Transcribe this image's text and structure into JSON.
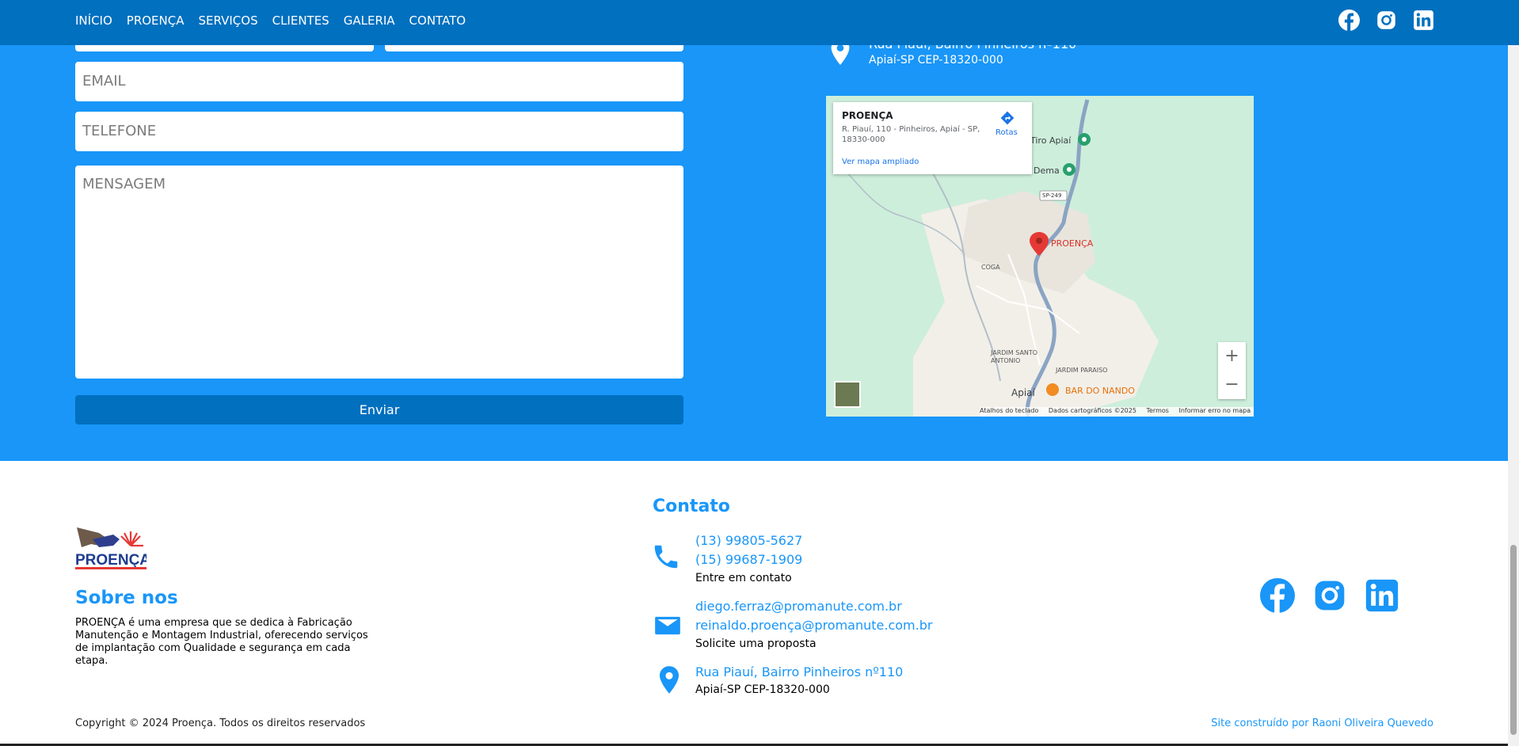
{
  "nav": {
    "links": [
      "INÍCIO",
      "PROENÇA",
      "SERVIÇOS",
      "CLIENTES",
      "GALERIA",
      "CONTATO"
    ],
    "social_icons": [
      "facebook-icon",
      "instagram-icon",
      "linkedin-icon"
    ]
  },
  "form": {
    "email_placeholder": "EMAIL",
    "phone_placeholder": "TELEFONE",
    "message_placeholder": "MENSAGEM",
    "submit_label": "Enviar"
  },
  "address_top": {
    "street": "Rua Piauí, Bairro Pinheiros nº110",
    "city": "Apiaí-SP CEP-18320-000"
  },
  "map": {
    "card_title": "PROENÇA",
    "card_address": "R. Piauí, 110 - Pinheiros, Apiaí - SP, 18330-000",
    "card_link": "Ver mapa ampliado",
    "directions_label": "Rotas",
    "labels": {
      "tiro_apiai": "Tiro Apiaí",
      "dema": "Dema",
      "sp249": "SP-249",
      "proenca": "PROENÇA",
      "coga": "COGA",
      "jardim_santo_antonio": "JARDIM SANTO ANTONIO",
      "jardim_paraiso": "JARDIM PARAISO",
      "apiai": "Apiaí",
      "bar_do_nando": "BAR DO NANDO"
    },
    "zoom_in": "+",
    "zoom_out": "−",
    "footer": [
      "Atalhos do teclado",
      "Dados cartográficos ©2025",
      "Termos",
      "Informar erro no mapa"
    ]
  },
  "footer": {
    "logo_text": "PROENÇA",
    "about_title": "Sobre nos",
    "about_text": "PROENÇA é uma empresa que se dedica à Fabricação Manutenção e Montagem Industrial, oferecendo serviços de implantação com Qualidade e segurança em cada etapa.",
    "contact_title": "Contato",
    "phone1": "(13) 99805-5627",
    "phone2": "(15) 99687-1909",
    "phone_sub": "Entre em contato",
    "email1": "diego.ferraz@promanute.com.br",
    "email2": "reinaldo.proença@promanute.com.br",
    "email_sub": "Solicite uma proposta",
    "address": "Rua Piauí, Bairro Pinheiros nº110",
    "address_sub": "Apiaí-SP CEP-18320-000",
    "copyright": "Copyright © 2024 Proença. Todos os direitos reservados",
    "credit": "Site construído por Raoni Oliveira Quevedo"
  },
  "colors": {
    "nav_bg": "#0070bf",
    "band_bg": "#1996f8",
    "accent": "#1996f8"
  }
}
